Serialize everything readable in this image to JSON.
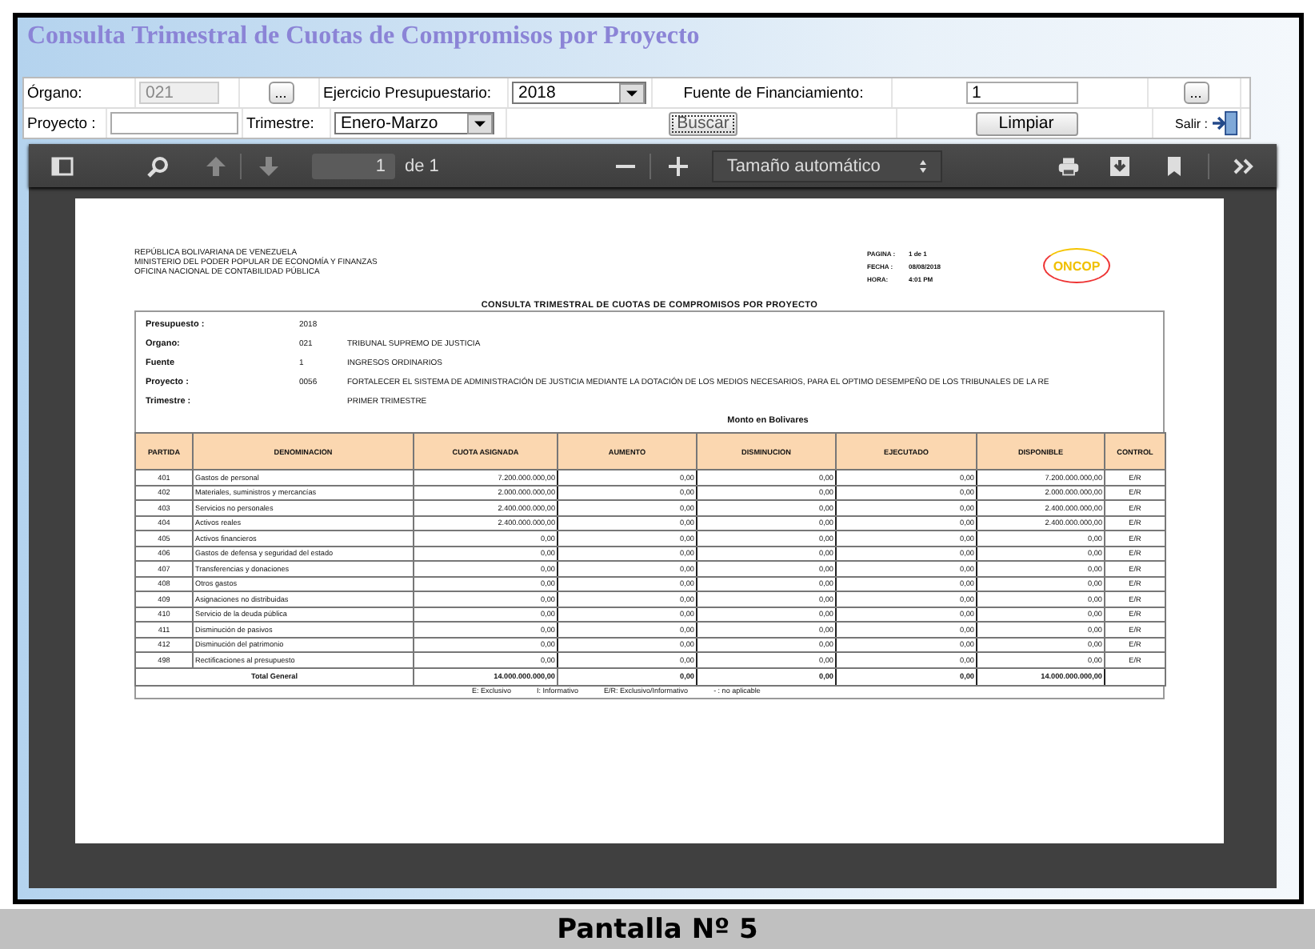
{
  "title": "Consulta Trimestral de Cuotas de Compromisos por Proyecto",
  "form": {
    "organo_label": "Órgano:",
    "organo_value": "021",
    "organo_disabled": true,
    "organo_button": "...",
    "ejercicio_label": "Ejercicio Presupuestario:",
    "ejercicio_value": "2018",
    "fuente_label": "Fuente de Financiamiento:",
    "fuente_value": "1",
    "fuente_button": "...",
    "proyecto_label": "Proyecto :",
    "trimestre_label": "Trimestre:",
    "trimestre_value": "Enero-Marzo",
    "buscar": "Buscar",
    "limpiar": "Limpiar",
    "salir_label": "Salir :"
  },
  "viewer": {
    "page": "1",
    "page_count": "de 1",
    "zoom": "Tamaño automático"
  },
  "report": {
    "header_lines": [
      "REPÚBLICA BOLIVARIANA DE VENEZUELA",
      "MINISTERIO DEL PODER POPULAR DE ECONOMÍA Y FINANZAS",
      "OFICINA NACIONAL DE CONTABILIDAD PÚBLICA"
    ],
    "meta": [
      {
        "label": "PAGINA :",
        "value": "1 de 1"
      },
      {
        "label": "FECHA :",
        "value": "08/08/2018"
      },
      {
        "label": "HORA:",
        "value": "4:01 PM"
      }
    ],
    "logo": "ONCOP",
    "heading": "CONSULTA TRIMESTRAL DE CUOTAS DE COMPROMISOS POR PROYECTO",
    "info": [
      {
        "label": "Presupuesto :",
        "code": "2018"
      },
      {
        "label": "Organo:",
        "code": "021",
        "description": "TRIBUNAL SUPREMO DE JUSTICIA"
      },
      {
        "label": "Fuente",
        "code": "1",
        "description": "INGRESOS ORDINARIOS"
      },
      {
        "label": "Proyecto :",
        "code": "0056",
        "description": "FORTALECER EL SISTEMA DE ADMINISTRACIÓN DE JUSTICIA MEDIANTE LA DOTACIÓN DE LOS MEDIOS NECESARIOS, PARA EL OPTIMO DESEMPEÑO DE LOS TRIBUNALES DE LA RE"
      },
      {
        "label": "Trimestre :",
        "description": "PRIMER TRIMESTRE"
      }
    ],
    "amount_caption": "Monto en Bolivares",
    "columns": [
      "PARTIDA",
      "DENOMINACION",
      "CUOTA ASIGNADA",
      "AUMENTO",
      "DISMINUCION",
      "EJECUTADO",
      "DISPONIBLE",
      "CONTROL"
    ],
    "rows": [
      [
        "401",
        "Gastos de personal",
        "7.200.000.000,00",
        "0,00",
        "0,00",
        "0,00",
        "7.200.000.000,00",
        "E/R"
      ],
      [
        "402",
        "Materiales, suministros y mercancías",
        "2.000.000.000,00",
        "0,00",
        "0,00",
        "0,00",
        "2.000.000.000,00",
        "E/R"
      ],
      [
        "403",
        "Servicios no personales",
        "2.400.000.000,00",
        "0,00",
        "0,00",
        "0,00",
        "2.400.000.000,00",
        "E/R"
      ],
      [
        "404",
        "Activos  reales",
        "2.400.000.000,00",
        "0,00",
        "0,00",
        "0,00",
        "2.400.000.000,00",
        "E/R"
      ],
      [
        "405",
        "Activos  financieros",
        "0,00",
        "0,00",
        "0,00",
        "0,00",
        "0,00",
        "E/R"
      ],
      [
        "406",
        "Gastos de defensa y seguridad del estado",
        "0,00",
        "0,00",
        "0,00",
        "0,00",
        "0,00",
        "E/R"
      ],
      [
        "407",
        "Transferencias y donaciones",
        "0,00",
        "0,00",
        "0,00",
        "0,00",
        "0,00",
        "E/R"
      ],
      [
        "408",
        "Otros gastos",
        "0,00",
        "0,00",
        "0,00",
        "0,00",
        "0,00",
        "E/R"
      ],
      [
        "409",
        "Asignaciones no distribuidas",
        "0,00",
        "0,00",
        "0,00",
        "0,00",
        "0,00",
        "E/R"
      ],
      [
        "410",
        "Servicio de la deuda pública",
        "0,00",
        "0,00",
        "0,00",
        "0,00",
        "0,00",
        "E/R"
      ],
      [
        "411",
        "Disminución de pasivos",
        "0,00",
        "0,00",
        "0,00",
        "0,00",
        "0,00",
        "E/R"
      ],
      [
        "412",
        "Disminución del patrimonio",
        "0,00",
        "0,00",
        "0,00",
        "0,00",
        "0,00",
        "E/R"
      ],
      [
        "498",
        "Rectificaciones al presupuesto",
        "0,00",
        "0,00",
        "0,00",
        "0,00",
        "0,00",
        "E/R"
      ]
    ],
    "total": {
      "label": "Total General",
      "values": [
        "14.000.000.000,00",
        "0,00",
        "0,00",
        "0,00",
        "14.000.000.000,00"
      ]
    },
    "legend": [
      "E: Exclusivo",
      "I: Informativo",
      "E/R: Exclusivo/Informativo",
      "- : no aplicable"
    ]
  },
  "caption": "Pantalla Nº 5"
}
